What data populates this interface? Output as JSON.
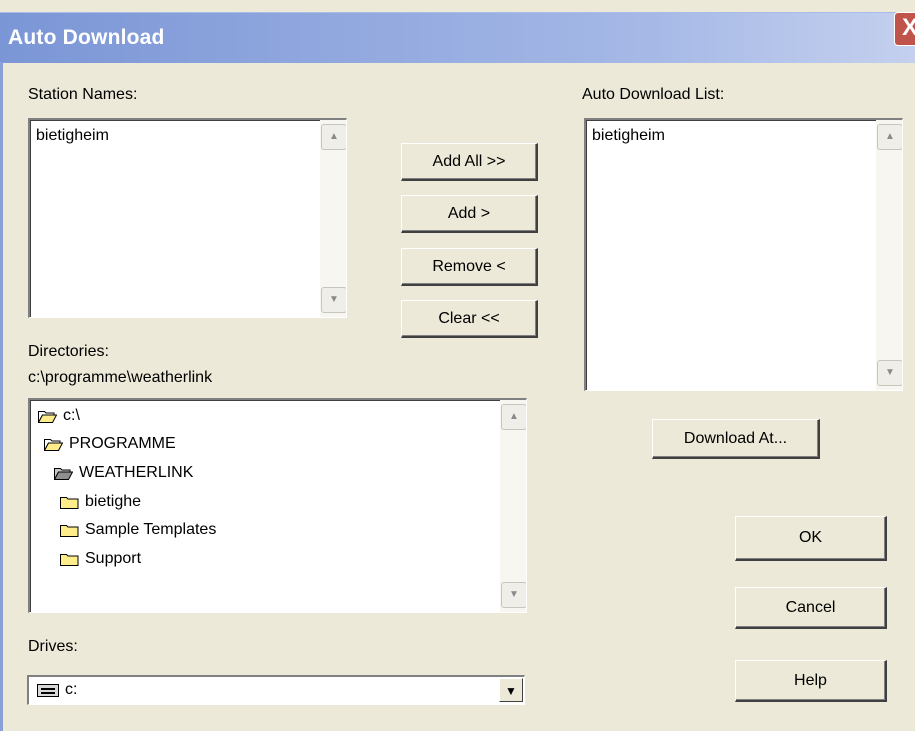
{
  "window": {
    "title": "Auto Download",
    "close_label": "X"
  },
  "station_names": {
    "label": "Station Names:",
    "items": [
      "bietigheim"
    ]
  },
  "auto_download_list": {
    "label": "Auto Download List:",
    "items": [
      "bietigheim"
    ]
  },
  "buttons": {
    "add_all": "Add All >>",
    "add": "Add >",
    "remove": "Remove <",
    "clear": "Clear <<",
    "download_at": "Download At...",
    "ok": "OK",
    "cancel": "Cancel",
    "help": "Help"
  },
  "directories": {
    "label": "Directories:",
    "path": "c:\\programme\\weatherlink",
    "tree": [
      {
        "name": "c:\\",
        "icon": "open-folder-icon"
      },
      {
        "name": "PROGRAMME",
        "icon": "open-folder-icon"
      },
      {
        "name": "WEATHERLINK",
        "icon": "open-folder-icon"
      },
      {
        "name": "bietighe",
        "icon": "folder-icon"
      },
      {
        "name": "Sample Templates",
        "icon": "folder-icon"
      },
      {
        "name": "Support",
        "icon": "folder-icon"
      }
    ]
  },
  "drives": {
    "label": "Drives:",
    "selected": "c:",
    "icon": "drive-icon"
  }
}
